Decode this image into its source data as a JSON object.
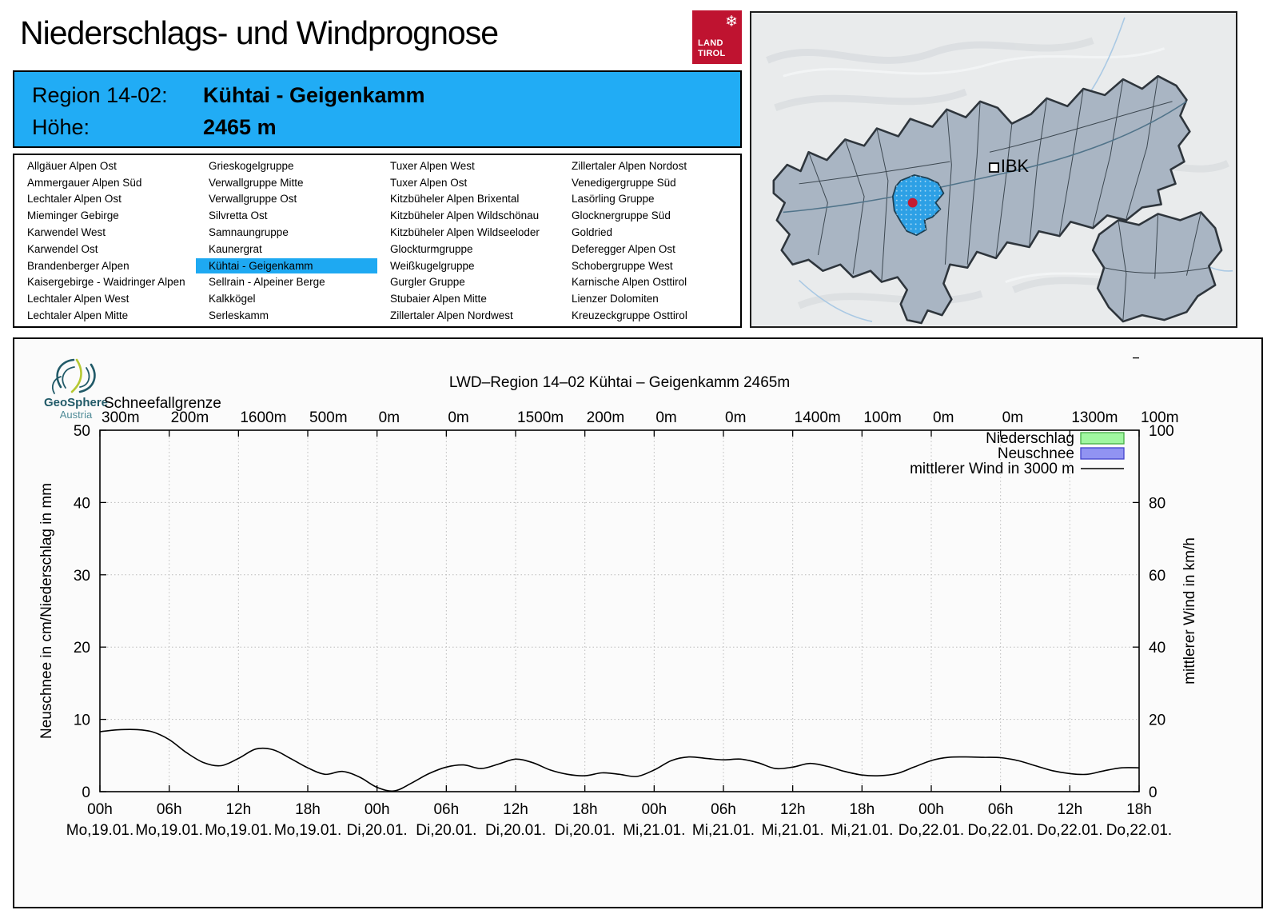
{
  "page": {
    "title": "Niederschlags- und Windprognose"
  },
  "tirol_logo": {
    "line1": "LAND",
    "line2": "TIROL",
    "eagle_icon": "snowflake-eagle",
    "color": "#bf1330"
  },
  "region_header": {
    "region_label": "Region 14-02:",
    "region_value": "Kühtai - Geigenkamm",
    "altitude_label": "Höhe:",
    "altitude_value": "2465 m",
    "bg_color": "#21acf5"
  },
  "region_list": {
    "selected": "Kühtai - Geigenkamm",
    "highlight_color": "#1ea9f2",
    "columns": [
      [
        "Allgäuer Alpen Ost",
        "Ammergauer Alpen Süd",
        "Lechtaler Alpen Ost",
        "Mieminger Gebirge",
        "Karwendel West",
        "Karwendel Ost",
        "Brandenberger Alpen",
        "Kaisergebirge - Waidringer Alpen",
        "Lechtaler Alpen West",
        "Lechtaler Alpen Mitte"
      ],
      [
        "Grieskogelgruppe",
        "Verwallgruppe Mitte",
        "Verwallgruppe Ost",
        "Silvretta Ost",
        "Samnaungruppe",
        "Kaunergrat",
        "Kühtai - Geigenkamm",
        "Sellrain - Alpeiner Berge",
        "Kalkkögel",
        "Serleskamm"
      ],
      [
        "Tuxer Alpen West",
        "Tuxer Alpen Ost",
        "Kitzbüheler Alpen Brixental",
        "Kitzbüheler Alpen Wildschönau",
        "Kitzbüheler Alpen Wildseeloder",
        "Glockturmgruppe",
        "Weißkugelgruppe",
        "Gurgler Gruppe",
        "Stubaier Alpen Mitte",
        "Zillertaler Alpen Nordwest"
      ],
      [
        "Zillertaler Alpen Nordost",
        "Venedigergruppe Süd",
        "Lasörling Gruppe",
        "Glocknergruppe Süd",
        "Goldried",
        "Deferegger Alpen Ost",
        "Schobergruppe West",
        "Karnische Alpen Osttirol",
        "Lienzer Dolomiten",
        "Kreuzeckgruppe Osttirol"
      ]
    ]
  },
  "map": {
    "ibk_label": "IBK",
    "region_fill": "#a9b5c3",
    "highlight_fill": "#2da0e5",
    "marker_color": "#c41b32"
  },
  "geosphere_logo": {
    "name": "GeoSphere",
    "sub": "Austria"
  },
  "chart_data": {
    "type": "line",
    "title": "LWD–Region 14–02 Kühtai – Geigenkamm 2465m",
    "snowline_label": "Schneefallgrenze",
    "snowline_values": [
      "300m",
      "200m",
      "1600m",
      "500m",
      "0m",
      "0m",
      "1500m",
      "200m",
      "0m",
      "0m",
      "1400m",
      "100m",
      "0m",
      "0m",
      "1300m",
      "100m"
    ],
    "ylabel_left": "Neuschnee in cm/Niederschlag in mm",
    "ylabel_right": "mittlerer Wind in km/h",
    "ylim_left": [
      0,
      50
    ],
    "ylim_right": [
      0,
      100
    ],
    "yticks_left": [
      0,
      10,
      20,
      30,
      40,
      50
    ],
    "yticks_right": [
      0,
      20,
      40,
      60,
      80,
      100
    ],
    "grid": "dotted",
    "legend_position": "top-right",
    "x_ticks": [
      {
        "time": "00h",
        "day": "Mo,19.01."
      },
      {
        "time": "06h",
        "day": "Mo,19.01."
      },
      {
        "time": "12h",
        "day": "Mo,19.01."
      },
      {
        "time": "18h",
        "day": "Mo,19.01."
      },
      {
        "time": "00h",
        "day": "Di,20.01."
      },
      {
        "time": "06h",
        "day": "Di,20.01."
      },
      {
        "time": "12h",
        "day": "Di,20.01."
      },
      {
        "time": "18h",
        "day": "Di,20.01."
      },
      {
        "time": "00h",
        "day": "Mi,21.01."
      },
      {
        "time": "06h",
        "day": "Mi,21.01."
      },
      {
        "time": "12h",
        "day": "Mi,21.01."
      },
      {
        "time": "18h",
        "day": "Mi,21.01."
      },
      {
        "time": "00h",
        "day": "Do,22.01."
      },
      {
        "time": "06h",
        "day": "Do,22.01."
      },
      {
        "time": "12h",
        "day": "Do,22.01."
      },
      {
        "time": "18h",
        "day": "Do,22.01."
      }
    ],
    "legend": [
      {
        "label": "Niederschlag",
        "type": "box",
        "fill": "#a0f7a0",
        "stroke": "#44ad44"
      },
      {
        "label": "Neuschnee",
        "type": "box",
        "fill": "#9193f2",
        "stroke": "#4343cc"
      },
      {
        "label": "mittlerer Wind in 3000 m",
        "type": "line",
        "color": "#000000"
      }
    ],
    "series": [
      {
        "name": "mittlerer Wind in 3000 m",
        "axis": "right",
        "unit": "km/h",
        "x_start_hour": 0,
        "x_step_hours": 1.5,
        "x_total_hours": 90,
        "values": [
          16.6,
          17.1,
          17.2,
          16.6,
          14.4,
          10.8,
          8.0,
          7.2,
          9.2,
          11.8,
          11.6,
          9.2,
          6.6,
          4.8,
          5.6,
          4.0,
          1.2,
          0.2,
          2.4,
          5.0,
          6.8,
          7.4,
          6.4,
          7.6,
          9.0,
          8.0,
          6.0,
          4.8,
          4.4,
          5.2,
          4.8,
          4.2,
          6.0,
          8.6,
          9.6,
          9.2,
          8.8,
          9.0,
          8.0,
          6.4,
          6.8,
          7.8,
          7.0,
          5.6,
          4.6,
          4.4,
          5.0,
          6.8,
          8.6,
          9.5,
          9.6,
          9.5,
          9.4,
          8.6,
          7.2,
          5.8,
          5.0,
          4.8,
          5.8,
          6.6,
          6.6
        ]
      },
      {
        "name": "Niederschlag",
        "axis": "left",
        "unit": "mm",
        "values_note": "no precipitation bars visible in forecast period",
        "values": []
      },
      {
        "name": "Neuschnee",
        "axis": "left",
        "unit": "cm",
        "values_note": "no new snow bars visible in forecast period",
        "values": []
      }
    ]
  }
}
